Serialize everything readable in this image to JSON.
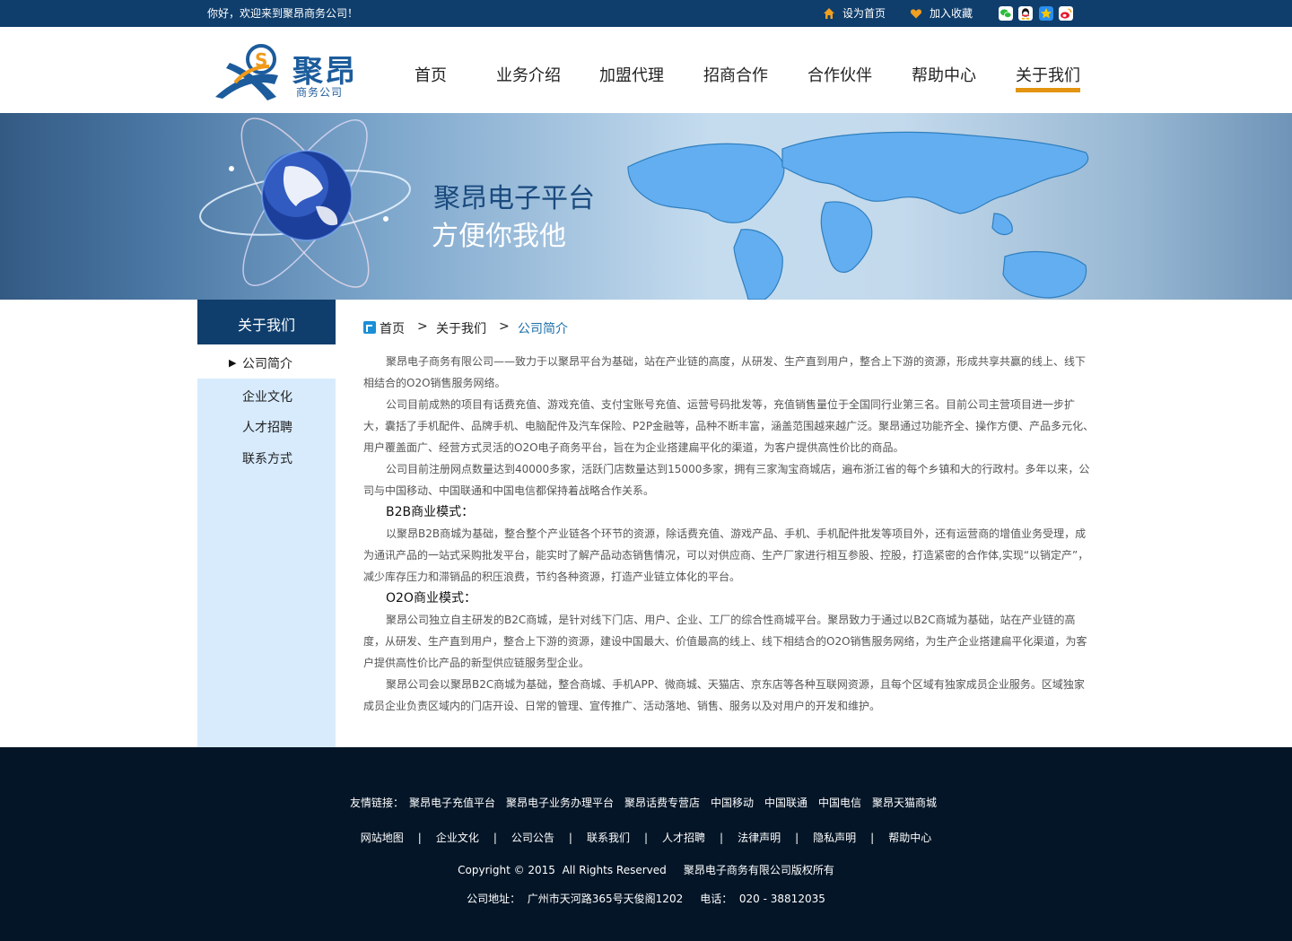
{
  "topbar": {
    "welcome": "你好，欢迎来到聚昂商务公司！",
    "set_home": "设为首页",
    "favorite": "加入收藏",
    "social_icons": [
      "wechat-icon",
      "qq-icon",
      "qzone-icon",
      "weibo-icon"
    ]
  },
  "logo": {
    "name": "聚昂",
    "sub": "商务公司"
  },
  "nav": {
    "items": [
      {
        "label": "首页"
      },
      {
        "label": "业务介绍"
      },
      {
        "label": "加盟代理"
      },
      {
        "label": "招商合作"
      },
      {
        "label": "合作伙伴"
      },
      {
        "label": "帮助中心"
      },
      {
        "label": "关于我们"
      }
    ],
    "active_index": 6
  },
  "banner": {
    "line1": "聚昂电子平台",
    "line2": "方便你我他"
  },
  "sidebar": {
    "heading": "关于我们",
    "items": [
      {
        "label": "公司简介"
      },
      {
        "label": "企业文化"
      },
      {
        "label": "人才招聘"
      },
      {
        "label": "联系方式"
      }
    ]
  },
  "breadcrumb": {
    "home": "首页",
    "sep": ">",
    "section": "关于我们",
    "current": "公司简介"
  },
  "content": {
    "p1": "聚昂电子商务有限公司——致力于以聚昂平台为基础，站在产业链的高度，从研发、生产直到用户，整合上下游的资源，形成共享共赢的线上、线下相结合的O2O销售服务网络。",
    "p2": "公司目前成熟的项目有话费充值、游戏充值、支付宝账号充值、运营号码批发等，充值销售量位于全国同行业第三名。目前公司主营项目进一步扩大，囊括了手机配件、品牌手机、电脑配件及汽车保险、P2P金融等，品种不断丰富，涵盖范围越来越广泛。聚昂通过功能齐全、操作方便、产品多元化、用户覆盖面广、经营方式灵活的O2O电子商务平台，旨在为企业搭建扁平化的渠道，为客户提供高性价比的商品。",
    "p3": "公司目前注册网点数量达到40000多家，活跃门店数量达到15000多家，拥有三家淘宝商城店，遍布浙江省的每个乡镇和大的行政村。多年以来，公司与中国移动、中国联通和中国电信都保持着战略合作关系。",
    "h_b2b": "B2B商业模式：",
    "p4": "以聚昂B2B商城为基础，整合整个产业链各个环节的资源，除话费充值、游戏产品、手机、手机配件批发等项目外，还有运营商的增值业务受理，成为通讯产品的一站式采购批发平台，能实时了解产品动态销售情况，可以对供应商、生产厂家进行相互参股、控股，打造紧密的合作体,实现“以销定产”，减少库存压力和滞销品的积压浪费，节约各种资源，打造产业链立体化的平台。",
    "h_o2o": "O2O商业模式：",
    "p5": "聚昂公司独立自主研发的B2C商城，是针对线下门店、用户、企业、工厂的综合性商城平台。聚昂致力于通过以B2C商城为基础，站在产业链的高度，从研发、生产直到用户，整合上下游的资源，建设中国最大、价值最高的线上、线下相结合的O2O销售服务网络，为生产企业搭建扁平化渠道，为客户提供高性价比产品的新型供应链服务型企业。",
    "p6": "聚昂公司会以聚昂B2C商城为基础，整合商城、手机APP、微商城、天猫店、京东店等各种互联网资源，且每个区域有独家成员企业服务。区域独家成员企业负责区域内的门店开设、日常的管理、宣传推广、活动落地、销售、服务以及对用户的开发和维护。"
  },
  "footer": {
    "friend_label": "友情链接：",
    "friend_links": [
      "聚昂电子充值平台",
      "聚昂电子业务办理平台",
      "聚昂话费专营店",
      "中国移动",
      "中国联通",
      "中国电信",
      "聚昂天猫商城"
    ],
    "nav_links": [
      "网站地图",
      "企业文化",
      "公司公告",
      "联系我们",
      "人才招聘",
      "法律声明",
      "隐私声明",
      "帮助中心"
    ],
    "separator": "|",
    "copyright": "Copyright © 2015  All Rights Reserved     聚昂电子商务有限公司版权所有",
    "address": "公司地址：  广州市天河路365号天俊阁1202     电话：  020 - 38812035"
  }
}
